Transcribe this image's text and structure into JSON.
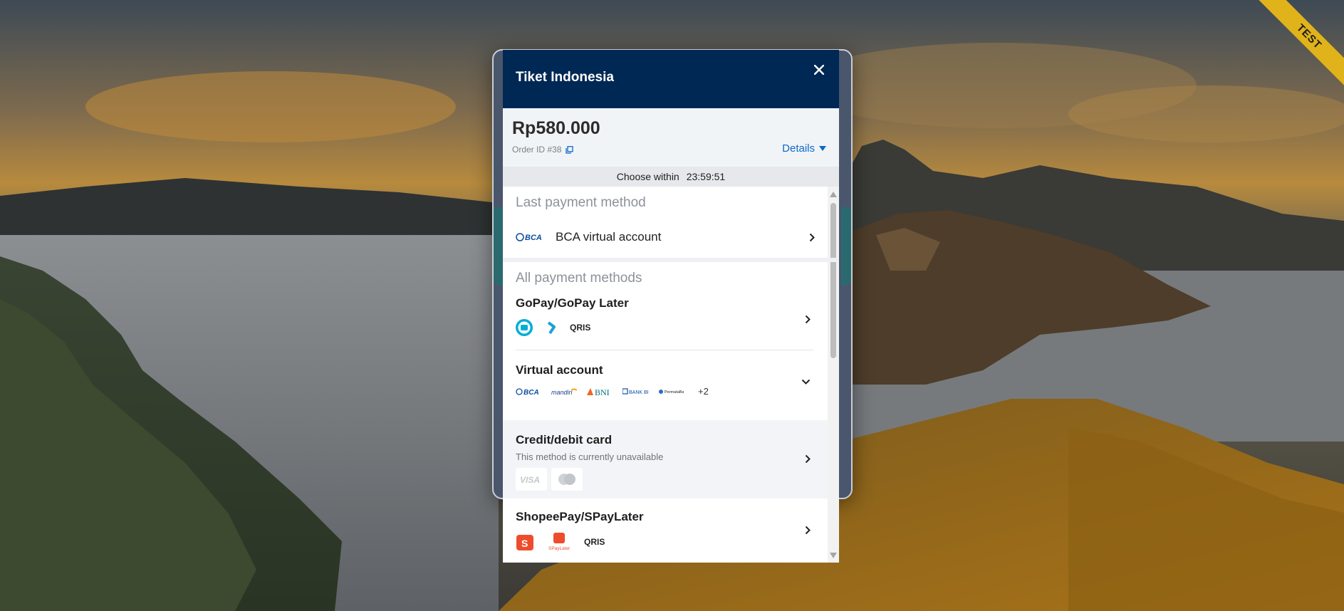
{
  "ribbon": {
    "label": "TEST"
  },
  "modal": {
    "merchant_name": "Tiket Indonesia",
    "amount": "Rp580.000",
    "order_id": "Order ID #38",
    "details_label": "Details",
    "timer_label": "Choose within",
    "timer_value": "23:59:51"
  },
  "last_payment": {
    "title": "Last payment method",
    "method_label": "BCA virtual account"
  },
  "all_payments": {
    "title": "All payment methods",
    "methods": [
      {
        "name": "GoPay/GoPay Later"
      },
      {
        "name": "Virtual account",
        "more": "+2"
      },
      {
        "name": "Credit/debit card",
        "note": "This method is currently unavailable"
      },
      {
        "name": "ShopeePay/SPayLater"
      }
    ]
  },
  "colors": {
    "header": "#002855",
    "link": "#0d68c8",
    "ribbon": "#e0b31b"
  }
}
